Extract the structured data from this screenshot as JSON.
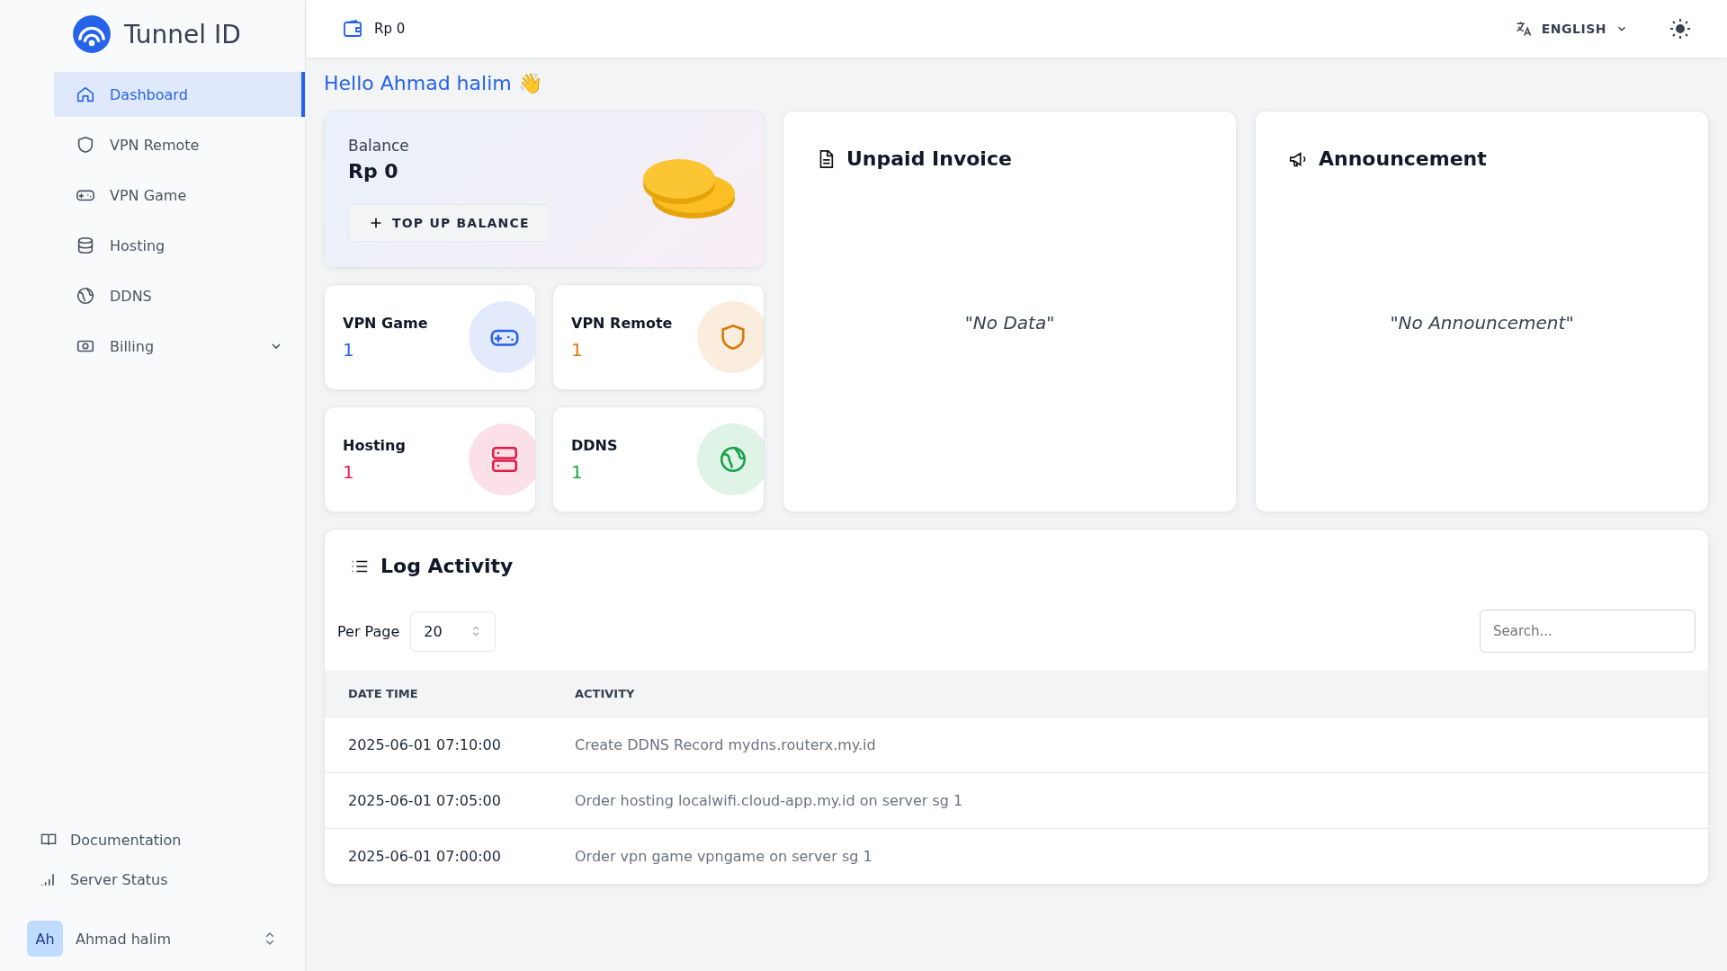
{
  "sidebar": {
    "brand": "Tunnel ID",
    "items": [
      {
        "label": "Dashboard",
        "selected": true,
        "kind": "link"
      },
      {
        "label": "VPN Remote",
        "selected": false,
        "kind": "link"
      },
      {
        "label": "VPN Game",
        "selected": false,
        "kind": "link"
      },
      {
        "label": "Hosting",
        "selected": false,
        "kind": "link"
      },
      {
        "label": "DDNS",
        "selected": false,
        "kind": "link"
      },
      {
        "label": "Billing",
        "selected": false,
        "kind": "menu"
      }
    ],
    "footer_links": [
      "Documentation",
      "Server Status"
    ],
    "user": {
      "initials": "Ah",
      "name": "Ahmad halim"
    }
  },
  "top_bar": {
    "balance": "Rp 0",
    "language": "ENGLISH"
  },
  "greeting": "Hello Ahmad halim 👋",
  "balance_card": {
    "label": "Balance",
    "amount": "Rp 0",
    "button": "TOP UP BALANCE"
  },
  "stats": [
    {
      "label": "VPN Game",
      "value": "1",
      "color": "#2563eb"
    },
    {
      "label": "VPN Remote",
      "value": "1",
      "color": "#d97706"
    },
    {
      "label": "Hosting",
      "value": "1",
      "color": "#e11d48"
    },
    {
      "label": "DDNS",
      "value": "1",
      "color": "#16a34a"
    }
  ],
  "unpaid_invoice": {
    "title": "Unpaid Invoice",
    "empty": "\"No Data\""
  },
  "announcement": {
    "title": "Announcement",
    "empty": "\"No Announcement\""
  },
  "log": {
    "title": "Log Activity",
    "per_page_label": "Per Page",
    "per_page": "20",
    "search_placeholder": "Search...",
    "columns": [
      "DATE TIME",
      "ACTIVITY"
    ],
    "rows": [
      [
        "2025-06-01 07:10:00",
        "Create DDNS Record mydns.routerx.my.id"
      ],
      [
        "2025-06-01 07:05:00",
        "Order hosting localwifi.cloud-app.my.id on server sg 1"
      ],
      [
        "2025-06-01 07:00:00",
        "Order vpn game vpngame on server sg 1"
      ]
    ]
  }
}
